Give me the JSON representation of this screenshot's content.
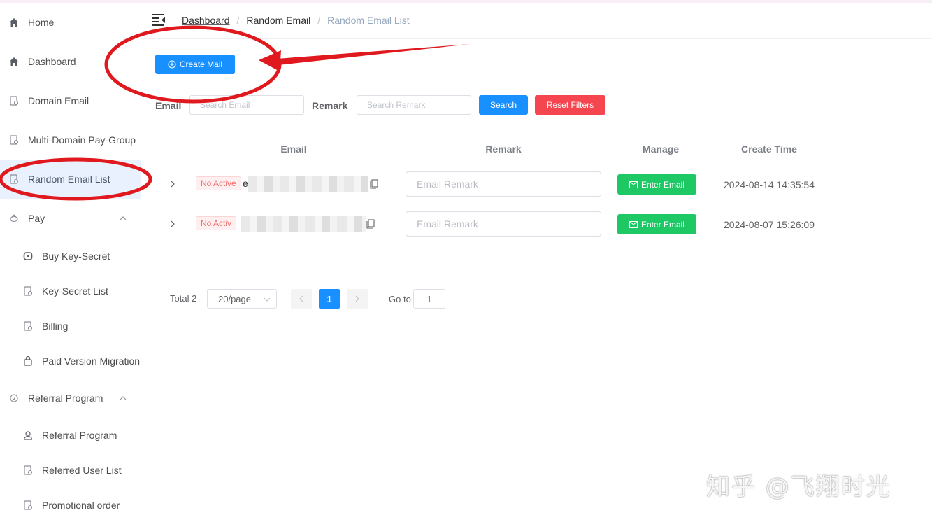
{
  "sidebar": {
    "items": [
      {
        "label": "Home",
        "icon": "home-icon"
      },
      {
        "label": "Dashboard",
        "icon": "home-icon"
      },
      {
        "label": "Domain Email",
        "icon": "document-icon"
      },
      {
        "label": "Multi-Domain Pay-Group",
        "icon": "document-icon"
      },
      {
        "label": "Random Email List",
        "icon": "document-icon",
        "active": true
      },
      {
        "label": "Pay",
        "icon": "wallet-icon"
      },
      {
        "label": "Buy Key-Secret",
        "icon": "key-icon"
      },
      {
        "label": "Key-Secret List",
        "icon": "document-icon"
      },
      {
        "label": "Billing",
        "icon": "document-icon"
      },
      {
        "label": "Paid Version Migration",
        "icon": "bag-icon"
      },
      {
        "label": "Referral Program",
        "icon": "gift-icon"
      },
      {
        "label": "Referral Program",
        "icon": "user-icon"
      },
      {
        "label": "Referred User List",
        "icon": "document-icon"
      },
      {
        "label": "Promotional order",
        "icon": "document-icon"
      }
    ]
  },
  "breadcrumb": [
    "Dashboard",
    "Random Email",
    "Random Email List"
  ],
  "toolbar": {
    "create_label": "Create Mail"
  },
  "filters": {
    "email_label": "Email",
    "email_placeholder": "Search Email",
    "remark_label": "Remark",
    "remark_placeholder": "Search Remark",
    "search_label": "Search",
    "reset_label": "Reset Filters"
  },
  "table": {
    "columns": [
      "Email",
      "Remark",
      "Manage",
      "Create Time"
    ],
    "rows": [
      {
        "status": "No Active",
        "email_prefix": "e",
        "remark_placeholder": "Email Remark",
        "action": "Enter Email",
        "create_time": "2024-08-14 14:35:54"
      },
      {
        "status": "No Activ",
        "email_prefix": "",
        "remark_placeholder": "Email Remark",
        "action": "Enter Email",
        "create_time": "2024-08-07 15:26:09"
      }
    ]
  },
  "pagination": {
    "total": "Total 2",
    "page_size": "20/page",
    "current": "1",
    "goto_label": "Go to",
    "goto_value": "1"
  },
  "watermark": "知乎 @飞翔时光",
  "colors": {
    "primary": "#1890ff",
    "danger": "#f5454f",
    "success": "#1ec864",
    "annotation": "#e0191e"
  }
}
